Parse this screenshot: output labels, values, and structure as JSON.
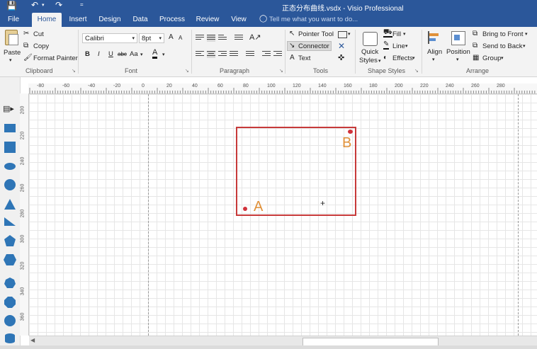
{
  "titlebar": {
    "title": "正态分布曲线.vsdx - Visio Professional",
    "qat_extra": "="
  },
  "tabs": [
    "File",
    "Home",
    "Insert",
    "Design",
    "Data",
    "Process",
    "Review",
    "View"
  ],
  "tell_me": "Tell me what you want to do...",
  "clipboard": {
    "paste": "Paste",
    "cut": "Cut",
    "copy": "Copy",
    "format_painter": "Format Painter",
    "group_label": "Clipboard"
  },
  "font": {
    "family": "Calibri",
    "size": "8pt",
    "bold": "B",
    "italic": "I",
    "underline": "U",
    "strike": "abc",
    "case": "Aa",
    "grow": "A",
    "shrink": "A",
    "color_letter": "A",
    "group_label": "Font"
  },
  "paragraph": {
    "group_label": "Paragraph"
  },
  "tools": {
    "pointer": "Pointer Tool",
    "connector": "Connector",
    "text": "Text",
    "group_label": "Tools"
  },
  "shape_styles": {
    "quick_styles": "Quick",
    "quick_styles_2": "Styles",
    "fill": "Fill",
    "line": "Line",
    "effects": "Effects",
    "group_label": "Shape Styles"
  },
  "arrange": {
    "align": "Align",
    "position": "Position",
    "bring_front": "Bring to Front",
    "send_back": "Send to Back",
    "group": "Group",
    "group_label": "Arrange"
  },
  "rulers": {
    "top_ticks": [
      "-80",
      "-60",
      "-40",
      "-20",
      "0",
      "20",
      "40",
      "60",
      "80",
      "100",
      "120",
      "140",
      "160",
      "180",
      "200",
      "220",
      "240",
      "260",
      "280"
    ],
    "left_ticks": [
      "200",
      "220",
      "240",
      "260",
      "280",
      "300",
      "320",
      "340",
      "360"
    ]
  },
  "canvas": {
    "label_a": "A",
    "label_b": "B",
    "crosshair": "+",
    "rect_color": "#c73a3a",
    "label_color": "#e0913a",
    "point_color": "#d1323b"
  },
  "colors": {
    "accent": "#2b579a",
    "ribbon": "#f3f3f3"
  }
}
